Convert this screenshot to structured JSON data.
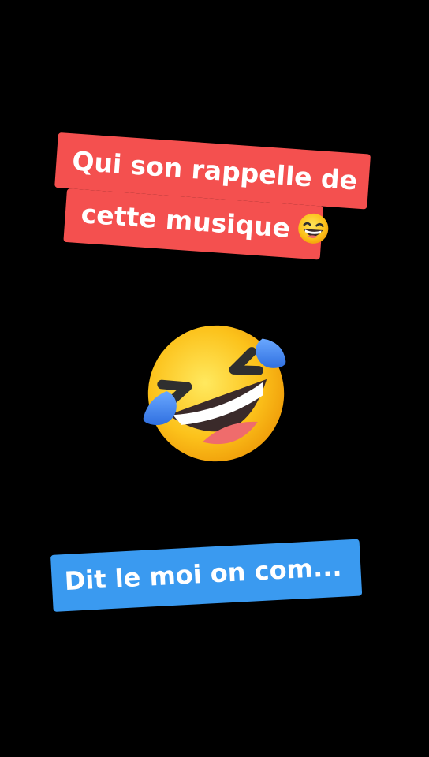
{
  "overlay": {
    "top_caption": {
      "line1": "Qui son rappelle de",
      "line2": "cette musique",
      "trailing_emoji": "grinning-squinting-face-emoji",
      "background_color": "#f4504f"
    },
    "center_emoji": "rolling-on-floor-laughing-emoji",
    "bottom_caption": {
      "text": "Dit le moi on com...",
      "background_color": "#3a9af0"
    }
  }
}
